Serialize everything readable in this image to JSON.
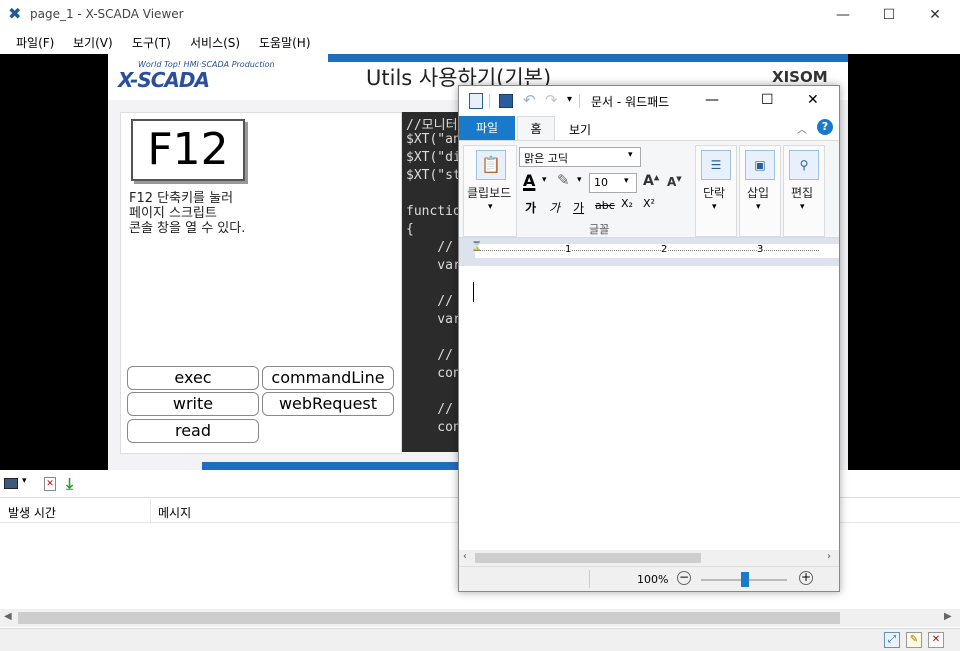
{
  "window": {
    "title": "page_1 - X-SCADA Viewer",
    "minimize": "—",
    "maximize": "☐",
    "close": "✕"
  },
  "menu": [
    "파일(F)",
    "보기(V)",
    "도구(T)",
    "서비스(S)",
    "도움말(H)"
  ],
  "slide": {
    "brand_small": "World Top! HMI·SCADA Production",
    "brand": "X-SCADA",
    "title": "Utils 사용하기(기본)",
    "vendor": "XISOM",
    "f12_key": "F12",
    "f12_desc": "F12 단축키를 눌러\n페이지 스크립트\n콘솔 창을 열 수 있다.",
    "buttons": {
      "exec": "exec",
      "commandLine": "commandLine",
      "write": "write",
      "webRequest": "webRequest",
      "read": "read"
    },
    "code": [
      "//모니터",
      "$XT(\"an",
      "$XT(\"di",
      "$XT(\"st",
      "",
      "functio",
      "{",
      "    //",
      "    var",
      "",
      "    //",
      "    var",
      "",
      "    //",
      "    con",
      "",
      "    //",
      "    con"
    ]
  },
  "log": {
    "col_time": "발생 시간",
    "col_message": "메시지"
  },
  "wordpad": {
    "title": "문서 - 워드패드",
    "tab_file": "파일",
    "tab_home": "홈",
    "tab_view": "보기",
    "clipboard": "클립보드",
    "font_name": "맑은 고딕",
    "font_size": "10",
    "font_group": "글꼴",
    "bold": "가",
    "italic": "가",
    "underline": "가",
    "strike": "abc",
    "subscript": "X₂",
    "superscript": "X²",
    "paragraph": "단락",
    "insert": "삽입",
    "edit": "편집",
    "ruler_marks": [
      "1",
      "2",
      "3"
    ],
    "zoom": "100%",
    "zoom_level_percent": 100
  }
}
